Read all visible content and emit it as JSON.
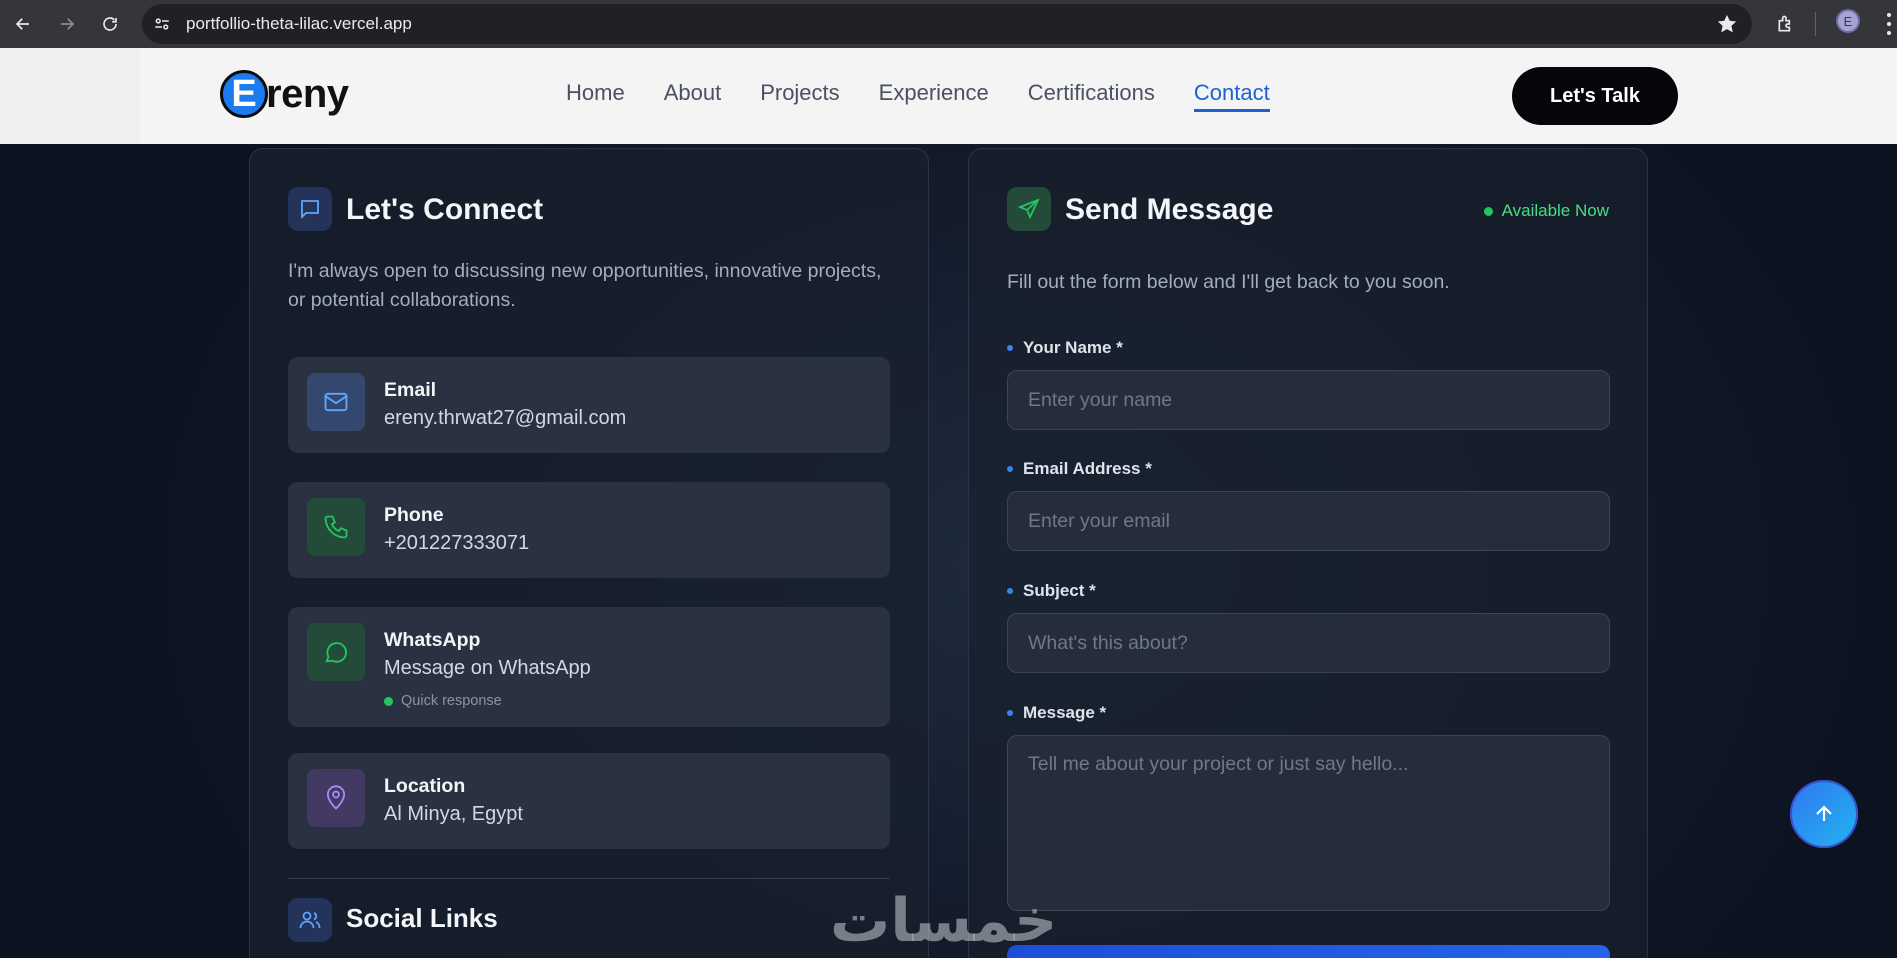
{
  "browser": {
    "url": "portfollio-theta-lilac.vercel.app",
    "profile_initial": "E"
  },
  "navbar": {
    "logo_letter": "E",
    "logo_rest": "reny",
    "links": [
      "Home",
      "About",
      "Projects",
      "Experience",
      "Certifications",
      "Contact"
    ],
    "active_link": "Contact",
    "cta_label": "Let's Talk"
  },
  "connect": {
    "title": "Let's Connect",
    "intro": "I'm always open to discussing new opportunities, innovative projects, or potential collaborations.",
    "items": [
      {
        "label": "Email",
        "value": "ereny.thrwat27@gmail.com",
        "icon": "mail-icon",
        "color": "#60a5fa"
      },
      {
        "label": "Phone",
        "value": "+201227333071",
        "icon": "phone-icon",
        "color": "#22c55e"
      },
      {
        "label": "WhatsApp",
        "value": "Message on WhatsApp",
        "sub": "Quick response",
        "icon": "message-circle-icon",
        "color": "#22c55e"
      },
      {
        "label": "Location",
        "value": "Al Minya, Egypt",
        "icon": "map-pin-icon",
        "color": "#a78bfa"
      }
    ],
    "social_title": "Social Links"
  },
  "message": {
    "title": "Send Message",
    "status": "Available Now",
    "intro": "Fill out the form below and I'll get back to you soon.",
    "fields": {
      "name": {
        "label": "Your Name *",
        "placeholder": "Enter your name"
      },
      "email": {
        "label": "Email Address *",
        "placeholder": "Enter your email"
      },
      "subject": {
        "label": "Subject *",
        "placeholder": "What's this about?"
      },
      "message": {
        "label": "Message *",
        "placeholder": "Tell me about your project or just say hello..."
      }
    }
  },
  "watermark": "خمسات",
  "colors": {
    "accent": "#1f5fd6",
    "available": "#4ade80",
    "page_bg": "#0e1422"
  }
}
